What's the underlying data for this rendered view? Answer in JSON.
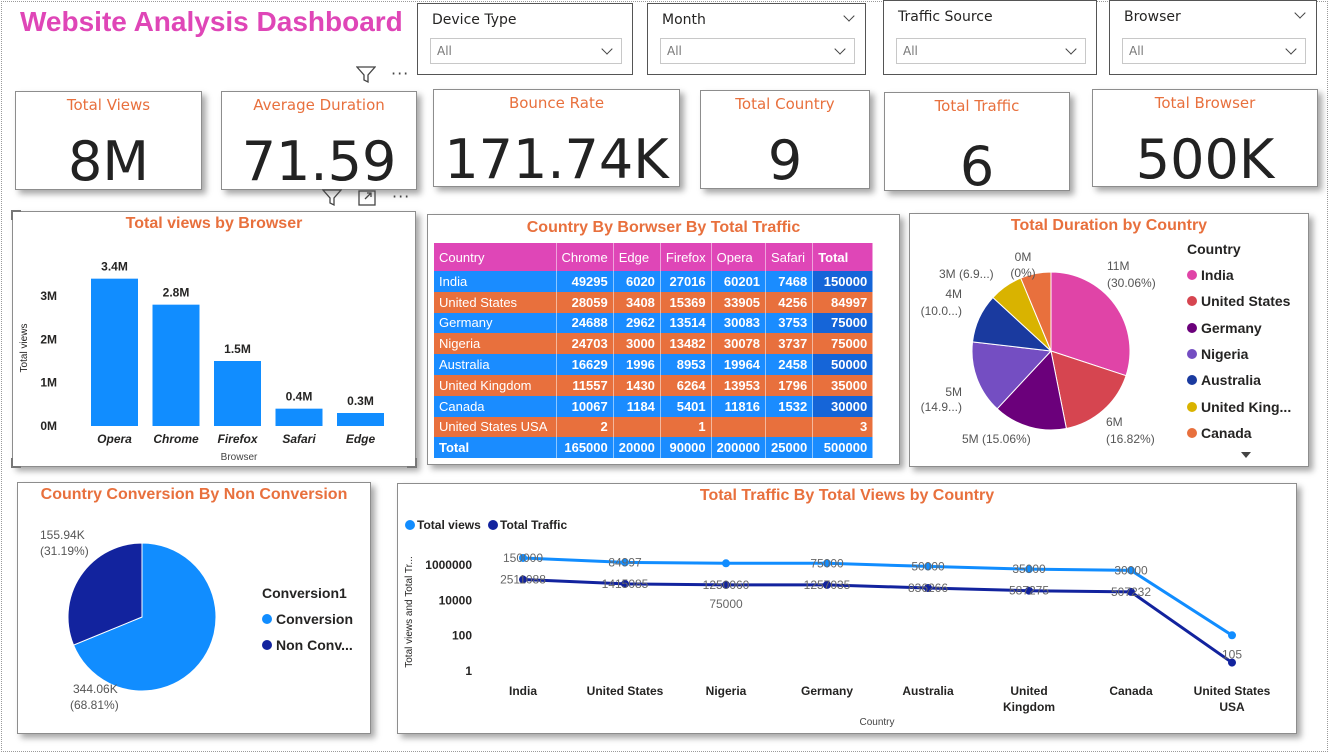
{
  "header": {
    "title": "Website Analysis Dashboard"
  },
  "slicers": [
    {
      "label": "Device Type",
      "value": "All"
    },
    {
      "label": "Month",
      "value": "All"
    },
    {
      "label": "Traffic Source",
      "value": "All"
    },
    {
      "label": "Browser",
      "value": "All"
    }
  ],
  "kpis": [
    {
      "label": "Total Views",
      "value": "8M"
    },
    {
      "label": "Average Duration",
      "value": "71.59"
    },
    {
      "label": "Bounce Rate",
      "value": "171.74K"
    },
    {
      "label": "Total Country",
      "value": "9"
    },
    {
      "label": "Total Traffic",
      "value": "6"
    },
    {
      "label": "Total Browser",
      "value": "500K"
    }
  ],
  "browser_chart": {
    "title": "Total views by Browser",
    "xlabel": "Browser",
    "ylabel": "Total views",
    "yticks": [
      "0M",
      "1M",
      "2M",
      "3M"
    ],
    "bar_color": "#118dff"
  },
  "table": {
    "title": "Country By Borwser By Total Traffic",
    "headers": [
      "Country",
      "Chrome",
      "Edge",
      "Firefox",
      "Opera",
      "Safari",
      "Total"
    ],
    "rows": [
      [
        "India",
        "49295",
        "6020",
        "27016",
        "60201",
        "7468",
        "150000"
      ],
      [
        "United States",
        "28059",
        "3408",
        "15369",
        "33905",
        "4256",
        "84997"
      ],
      [
        "Germany",
        "24688",
        "2962",
        "13514",
        "30083",
        "3753",
        "75000"
      ],
      [
        "Nigeria",
        "24703",
        "3000",
        "13482",
        "30078",
        "3737",
        "75000"
      ],
      [
        "Australia",
        "16629",
        "1996",
        "8953",
        "19964",
        "2458",
        "50000"
      ],
      [
        "United Kingdom",
        "11557",
        "1430",
        "6264",
        "13953",
        "1796",
        "35000"
      ],
      [
        "Canada",
        "10067",
        "1184",
        "5401",
        "11816",
        "1532",
        "30000"
      ],
      [
        "United States USA",
        "2",
        "",
        "1",
        "",
        "",
        "3"
      ]
    ],
    "total_row": [
      "Total",
      "165000",
      "20000",
      "90000",
      "200000",
      "25000",
      "500000"
    ],
    "colors": {
      "blue": "#1a8cff",
      "orange": "#e8703d",
      "header": "#df46b7",
      "total_col": "#1565d8"
    }
  },
  "duration_chart": {
    "title": "Total Duration by Country",
    "legend_title": "Country",
    "legend": [
      {
        "name": "India",
        "color": "#e044a7"
      },
      {
        "name": "United States",
        "color": "#d64550"
      },
      {
        "name": "Germany",
        "color": "#6b007b"
      },
      {
        "name": "Nigeria",
        "color": "#744ec2"
      },
      {
        "name": "Australia",
        "color": "#1a3a9f"
      },
      {
        "name": "United King...",
        "color": "#d9b300"
      },
      {
        "name": "Canada",
        "color": "#e8703d"
      }
    ],
    "labels": {
      "india": [
        "11M",
        "(30.06%)"
      ],
      "us": [
        "6M",
        "(16.82%)"
      ],
      "germany": [
        "5M (15.06%)"
      ],
      "nigeria": [
        "5M",
        "(14.9...)"
      ],
      "australia": [
        "4M",
        "(10.0...)"
      ],
      "uk": [
        "3M (6.9...)"
      ],
      "canada": [
        "0M",
        "(0%)"
      ]
    }
  },
  "conversion_chart": {
    "title": "Country Conversion By Non Conversion",
    "legend_title": "Conversion1",
    "legend": [
      {
        "name": "Conversion",
        "color": "#118dff"
      },
      {
        "name": "Non Conv...",
        "color": "#12239e"
      }
    ],
    "labels": {
      "non_conversion": [
        "155.94K",
        "(31.19%)"
      ],
      "conversion": [
        "344.06K",
        "(68.81%)"
      ]
    }
  },
  "line_chart": {
    "title": "Total Traffic By Total Views by Country",
    "xlabel": "Country",
    "ylabel": "Total views and Total Tr...",
    "yticks": [
      "1",
      "100",
      "10000",
      "1000000"
    ],
    "legend": [
      {
        "name": "Total views",
        "color": "#118dff"
      },
      {
        "name": "Total Traffic",
        "color": "#12239e"
      }
    ]
  },
  "chart_data": [
    {
      "type": "bar",
      "title": "Total views by Browser",
      "xlabel": "Browser",
      "ylabel": "Total views",
      "categories": [
        "Opera",
        "Chrome",
        "Firefox",
        "Safari",
        "Edge"
      ],
      "values": [
        3400000,
        2800000,
        1500000,
        400000,
        300000
      ],
      "data_labels": [
        "3.4M",
        "2.8M",
        "1.5M",
        "0.4M",
        "0.3M"
      ],
      "ylim": [
        0,
        3600000
      ]
    },
    {
      "type": "pie",
      "title": "Total Duration by Country",
      "categories": [
        "India",
        "United States",
        "Germany",
        "Nigeria",
        "Australia",
        "United Kingdom",
        "Canada"
      ],
      "values": [
        30.06,
        16.82,
        15.06,
        14.9,
        10.0,
        6.9,
        6.26
      ]
    },
    {
      "type": "pie",
      "title": "Country Conversion By Non Conversion",
      "categories": [
        "Conversion",
        "Non Conversion"
      ],
      "values": [
        344060,
        155940
      ]
    },
    {
      "type": "line",
      "title": "Total Traffic By Total Views by Country",
      "xlabel": "Country",
      "ylabel": "Total views and Total Tr...",
      "log_scale": true,
      "categories": [
        "India",
        "United States",
        "Nigeria",
        "Germany",
        "Australia",
        "United Kingdom",
        "Canada",
        "United States USA"
      ],
      "series": [
        {
          "name": "Total views",
          "values": [
            2500000,
            1400000,
            1250000,
            1250000,
            830000,
            580000,
            500000,
            105
          ]
        },
        {
          "name": "Total Traffic",
          "values": [
            150000,
            84997,
            75000,
            75000,
            50000,
            35000,
            30000,
            3
          ]
        }
      ],
      "point_labels_views": [
        "150000",
        "84997",
        "",
        "75000",
        "50000",
        "35000",
        "30000",
        ""
      ],
      "point_labels_traffic": [
        "2511088",
        "1415085",
        "1250060",
        "1257035",
        "836266",
        "587275",
        "507232",
        "105"
      ],
      "extra_label": "75000"
    }
  ]
}
